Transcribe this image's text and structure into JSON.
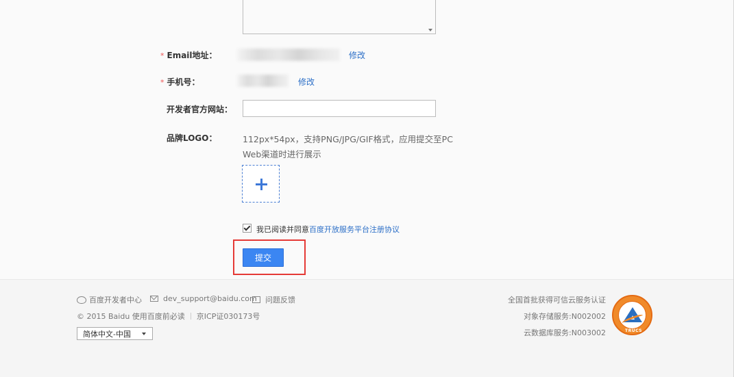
{
  "form": {
    "email_label": "Email地址：",
    "email_required_mark": "*",
    "email_edit_link": "修改",
    "phone_label": "手机号：",
    "phone_required_mark": "*",
    "phone_edit_link": "修改",
    "website_label": "开发者官方网站：",
    "website_value": "",
    "logo_label": "品牌LOGO：",
    "logo_hint_line1": "112px*54px，支持PNG/JPG/GIF格式，应用提交至PC",
    "logo_hint_line2": "Web渠道时进行展示",
    "agree_text": "我已阅读并同意",
    "agree_link": "百度开放服务平台注册协议",
    "agree_checked": true,
    "submit_label": "提交",
    "highlight_color": "#e53935",
    "accent_color": "#3b86f2"
  },
  "footer": {
    "weibo_label": "百度开发者中心",
    "email_label": "dev_support@baidu.com",
    "feedback_label": "问题反馈",
    "copyright": "© 2015 Baidu 使用百度前必读",
    "icp": "京ICP证030173号",
    "language_selected": "简体中文-中国",
    "cert_title": "全国首批获得可信云服务认证",
    "storage_service": "对象存储服务:N002002",
    "database_service": "云数据库服务:N003002",
    "badge_text": "TRUCS"
  }
}
